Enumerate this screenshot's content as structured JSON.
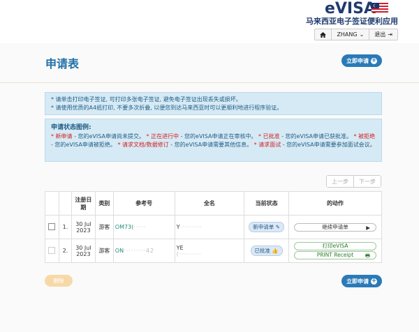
{
  "header": {
    "logo_text": "eVISA",
    "subtitle": "马来西亚电子签证便利应用",
    "user": "ZHANG",
    "logout": "退出"
  },
  "page": {
    "title": "申请表",
    "new_button": "立即申请"
  },
  "notices": {
    "line1": "* 请单击打印电子签证, 可打印多张电子签证, 避免电子签证出现丢失或损坏。",
    "line2": "* 请使用优质的A4纸打印, 不要多次折叠, 以便您到达马来西亚时可以更顺利地进行程序验证。"
  },
  "legend": {
    "title": "申请状态图例:",
    "items": [
      {
        "term": "* 新申请",
        "desc": " - 您的eVISA申请尚未提交。 "
      },
      {
        "term": "* 正在进行中",
        "desc": " - 您的eVISA申请正在审核中。 "
      },
      {
        "term": "* 已批准",
        "desc": " - 您的eVISA申请已获批准。 "
      },
      {
        "term": "* 被拒绝",
        "desc": " - 您的eVISA申请被拒绝。 "
      },
      {
        "term": "* 请求文档/数据修订",
        "desc": " - 您的eVISA申请需要其他信息。 "
      },
      {
        "term": "* 请求面试",
        "desc": " - 您的eVISA申请需要参加面试会议。"
      }
    ]
  },
  "pager": {
    "prev": "上一步",
    "next": "下一步"
  },
  "table": {
    "headers": [
      "",
      "",
      "注册日期",
      "类别",
      "参考号",
      "全名",
      "当前状态",
      "的动作"
    ],
    "rows": [
      {
        "no": "1.",
        "date": "30 Jul 2023",
        "category": "游客",
        "ref": "OM73(",
        "ref_blur": "·····",
        "name": "Y",
        "name_blur": "·········",
        "status": "新申请单",
        "actions": [
          "继续申请单"
        ]
      },
      {
        "no": "2.",
        "date": "30 Jul 2023",
        "category": "游客",
        "ref": "ON",
        "ref_blur": "·········42",
        "name": "YE",
        "name_blur": "(·········",
        "status": "已批准",
        "actions": [
          "打印eVISA",
          "PRINT Receipt"
        ]
      }
    ]
  },
  "footer": {
    "cancel": "删除",
    "new_button": "立即申请"
  }
}
